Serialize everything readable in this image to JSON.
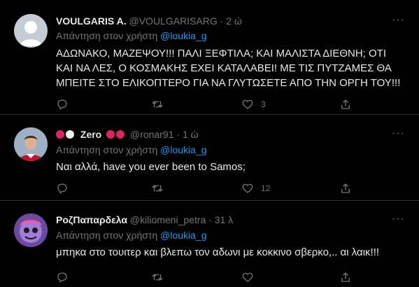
{
  "tweets": [
    {
      "name": "VOULGARIS A.",
      "handle": "@VOULGARISARG",
      "time": "2 ώ",
      "reply_prefix": "Απάντηση στον χρήστη",
      "reply_to": "@loukia_g",
      "text": "ΑΔΩΝΑΚΟ, ΜΑΖΕΨΟΥ!!! ΠΑΛΙ ΞΕΦΤΙΛΑ; ΚΑΙ ΜΑΛΙΣΤΑ ΔΙΕΘΝΗ; ΟΤΙ ΚΑΙ ΝΑ ΛΕΣ, Ο ΚΟΣΜΑΚΗΣ ΕΧΕΙ ΚΑΤΑΛΑΒΕΙ! ΜΕ ΤΙΣ ΠΥΤΖΑΜΕΣ ΘΑ ΜΠΕΙΤΕ ΣΤΟ ΕΛΙΚΟΠΤΕΡΟ ΓΙΑ ΝΑ ΓΛΥΤΩΣΕΤΕ ΑΠΟ ΤΗΝ ΟΡΓΗ ΤΟΥ!!!",
      "likes": "3"
    },
    {
      "name": "Zero",
      "handle": "@ronar91",
      "time": "1 ώ",
      "reply_prefix": "Απάντηση στον χρήστη",
      "reply_to": "@loukia_g",
      "text": "Ναι αλλά, have you ever been to Samos;",
      "likes": "12"
    },
    {
      "name": "ΡοζΠαπαρδελα",
      "handle": "@kiliomeni_petra",
      "time": "31 λ",
      "reply_prefix": "Απάντηση στον χρήστη",
      "reply_to": "@loukia_g",
      "text": "μπηκα στο τουιτερ και βλεπω τον αδωνι με κοκκινο σβερκο,.. αι λαικ!!!",
      "likes": ""
    }
  ],
  "more_label": "···",
  "separator": "·",
  "colors": {
    "background": "#000000",
    "accent": "#1d9bf0",
    "muted": "#71767b",
    "red": "#e0245e"
  },
  "icons": [
    "reply-icon",
    "retweet-icon",
    "like-icon",
    "share-icon",
    "more-icon"
  ]
}
